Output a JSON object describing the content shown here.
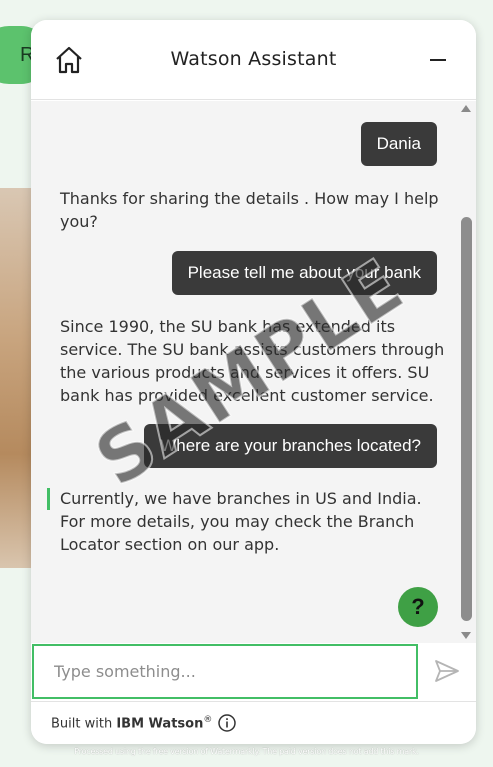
{
  "background": {
    "pill_label": "R"
  },
  "header": {
    "title": "Watson Assistant",
    "home_icon": "home-icon",
    "minimize_icon": "minimize-icon"
  },
  "conversation": {
    "messages": [
      {
        "from": "user",
        "text": "Dania"
      },
      {
        "from": "bot",
        "text": "Thanks for sharing the details . How may I help you?"
      },
      {
        "from": "user",
        "text": "Please tell me about your bank"
      },
      {
        "from": "bot",
        "text": "Since 1990, the SU bank has extended its service. The SU bank assists customers through the various products and services it offers. SU bank has provided excellent customer service."
      },
      {
        "from": "user",
        "text": "Where are your branches located?"
      },
      {
        "from": "bot",
        "text": "Currently, we have branches in US and India. For more details, you may check the Branch Locator section on our app.",
        "latest": true
      }
    ],
    "help_label": "?"
  },
  "input": {
    "value": "",
    "placeholder": "Type something...",
    "send_icon": "send-icon"
  },
  "footer": {
    "prefix": "Built with",
    "brand": "IBM Watson",
    "trademark": "®",
    "info_icon": "info-icon"
  },
  "watermark": "SAMPLE",
  "notice": "Processed using the free version of Watermarkly. The paid version does not add this mark.",
  "colors": {
    "accent": "#42be65",
    "user_bubble": "#3a3a3a",
    "help_button": "#3fa045"
  }
}
